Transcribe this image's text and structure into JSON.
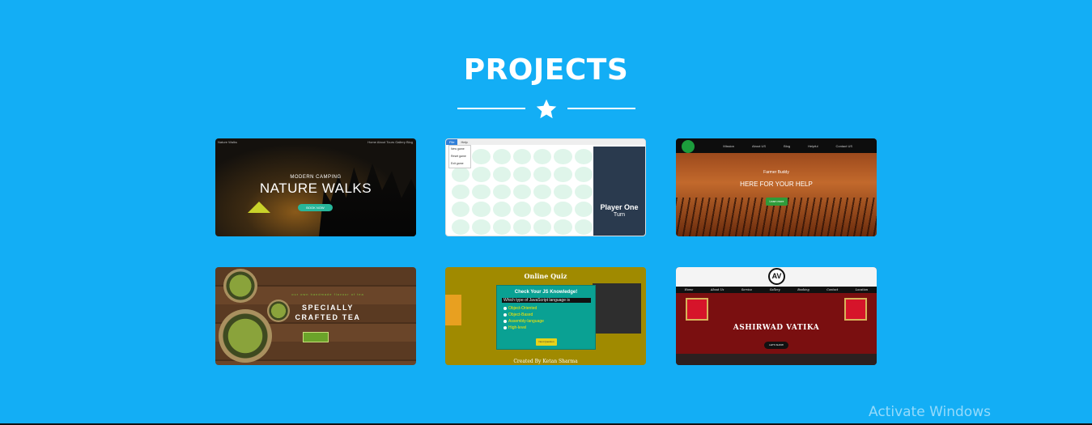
{
  "page": {
    "title": "PROJECTS",
    "divider_icon": "star-icon",
    "background_color": "#13aef5",
    "watermark": "Activate Windows"
  },
  "projects": [
    {
      "name": "nature-walks",
      "nav_brand": "Nature Walks",
      "nav_links": [
        "Home",
        "About",
        "Tours",
        "Gallery",
        "Blog"
      ],
      "kicker": "MODERN CAMPING",
      "headline": "NATURE WALKS",
      "button": "BOOK NOW",
      "accent": "#27b69a"
    },
    {
      "name": "connect-four",
      "menu": [
        "File",
        "Help"
      ],
      "dropdown": [
        "New game",
        "Reset game",
        "Exit game"
      ],
      "player_label": "Player One",
      "turn_label": "Turn",
      "panel_color": "#2a3a4e"
    },
    {
      "name": "farmer-buddy",
      "nav_links": [
        "Mission",
        "About US",
        "Blog",
        "Helpful",
        "Contact US"
      ],
      "brand": "Farmer Buddy",
      "headline": "HERE FOR YOUR HELP",
      "button": "Learn more"
    },
    {
      "name": "crafted-tea",
      "kicker": "our own handmade flavour of tea",
      "line1": "SPECIALLY",
      "line2": "CRAFTED TEA"
    },
    {
      "name": "online-quiz",
      "title": "Online Quiz",
      "box_heading": "Check Your JS Knowledge!",
      "question": "Which type of JavaScript language is",
      "options": [
        "Object-Oriented",
        "Object-Based",
        "Assembly-language",
        "High-level"
      ],
      "button": "Next Question",
      "credit": "Created By Ketan Sharma",
      "background_color": "#a08a00",
      "box_color": "#0aa193"
    },
    {
      "name": "ashirwad-vatika",
      "logo_text": "AV",
      "nav_links": [
        "Home",
        "About Us",
        "Service",
        "Gallery",
        "Booking",
        "Contact",
        "Location"
      ],
      "headline": "ASHIRWAD VATIKA",
      "button": "LETS SHOW",
      "background_color": "#7a0f10"
    }
  ]
}
